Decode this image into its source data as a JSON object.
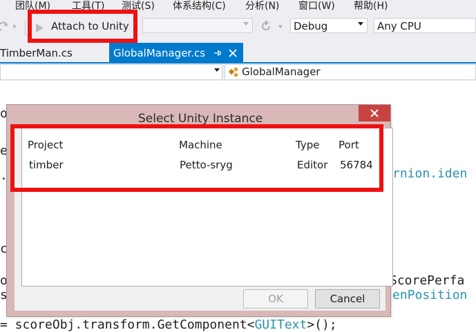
{
  "menu": {
    "items": [
      "团队(M)",
      "工具(T)",
      "测试(S)",
      "体系结构(C)",
      "分析(N)",
      "窗口(W)",
      "帮助(H)"
    ]
  },
  "toolbar": {
    "attach_button": "Attach to Unity",
    "target_dropdown": "",
    "config_dropdown": "Debug",
    "platform_dropdown": "Any CPU"
  },
  "tabs": [
    {
      "label": "TimberMan.cs",
      "active": false
    },
    {
      "label": "GlobalManager.cs",
      "active": true
    }
  ],
  "navbar": {
    "class_selector": "GlobalManager"
  },
  "editor": {
    "fragments": [
      {
        "text": "on",
        "color": "#1e1e1e"
      },
      {
        "text": "e",
        "color": "#1e1e1e"
      },
      {
        "text": "rnion.iden",
        "color": "#2b91af"
      },
      {
        "text": ".",
        "color": "#1e1e1e"
      },
      {
        "text": "co",
        "color": "#1e1e1e"
      },
      {
        "text": "or",
        "color": "#1e1e1e"
      },
      {
        "text": "si",
        "color": "#1e1e1e"
      },
      {
        "text": "ScorePerfa",
        "color": "#1e1e1e"
      },
      {
        "text": "enPosition",
        "color": "#2b91af"
      },
      {
        "text": "= scoreObj.transform.GetComponent<",
        "color": "#1e1e1e"
      },
      {
        "text": "GUIText",
        "color": "#2b91af"
      },
      {
        "text": ">();",
        "color": "#1e1e1e"
      }
    ]
  },
  "dialog": {
    "title": "Select Unity Instance",
    "columns": [
      "Project",
      "Machine",
      "Type",
      "Port"
    ],
    "rows": [
      {
        "project": "timber",
        "machine": "Petto-sryg",
        "type": "Editor",
        "port": "56784"
      }
    ],
    "ok_label": "OK",
    "cancel_label": "Cancel"
  },
  "colors": {
    "annotation": "#ee1111",
    "vs_accent": "#007acc",
    "dialog_frame": "#d9b8b8",
    "close_button": "#c74341",
    "code_type": "#2b91af"
  }
}
